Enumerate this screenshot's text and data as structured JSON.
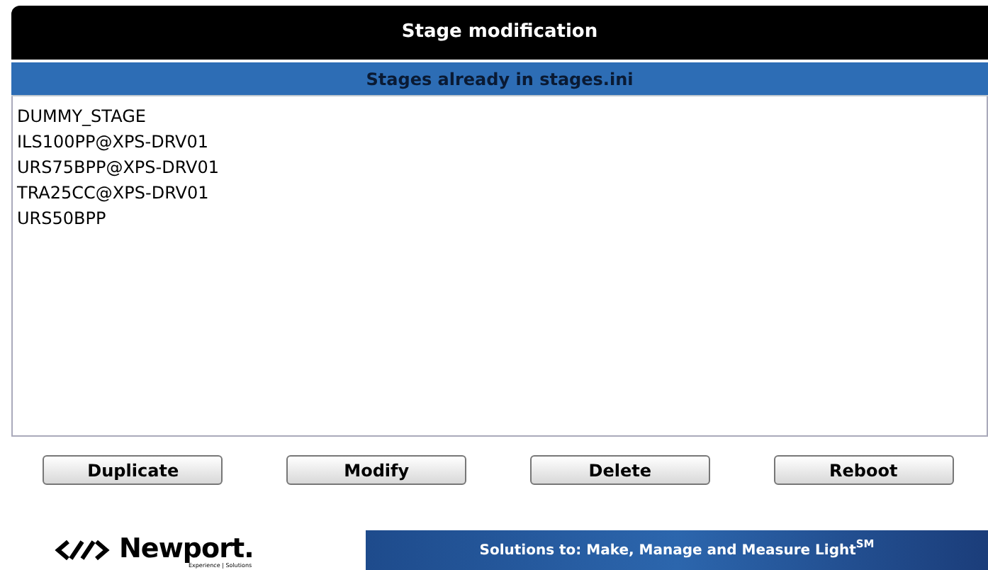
{
  "window": {
    "title": "Stage modification"
  },
  "list": {
    "header": "Stages already in stages.ini",
    "items": [
      "DUMMY_STAGE",
      "ILS100PP@XPS-DRV01",
      "URS75BPP@XPS-DRV01",
      "TRA25CC@XPS-DRV01",
      "URS50BPP"
    ]
  },
  "buttons": [
    "Duplicate",
    "Modify",
    "Delete",
    "Reboot"
  ],
  "footer": {
    "logo": "Newport.",
    "tagline": "Experience | Solutions",
    "banner": "Solutions to: Make, Manage and Measure Light$^{SM}$"
  }
}
